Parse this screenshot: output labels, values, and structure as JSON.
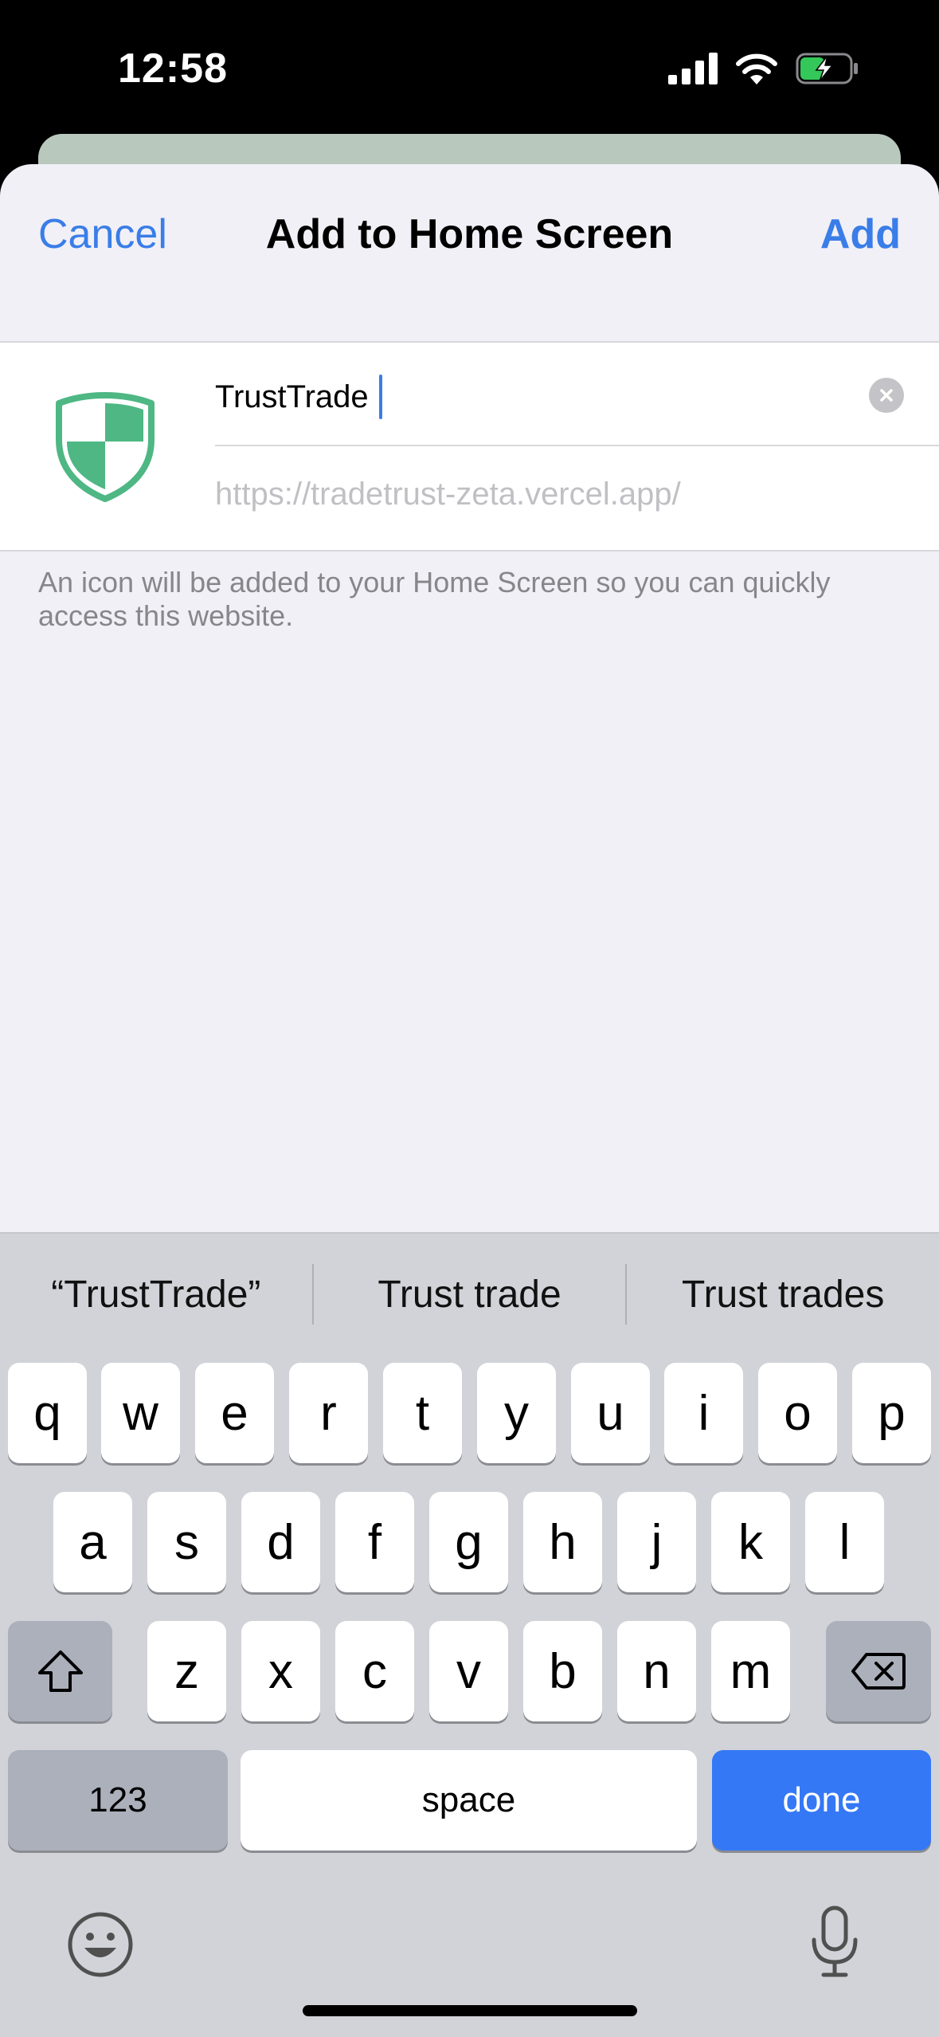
{
  "status_bar": {
    "time": "12:58"
  },
  "nav": {
    "cancel_label": "Cancel",
    "title": "Add to Home Screen",
    "add_label": "Add"
  },
  "form": {
    "name_value": "TrustTrade",
    "url": "https://tradetrust-zeta.vercel.app/",
    "helper_text": "An icon will be added to your Home Screen so you can quickly access this website."
  },
  "icon_colors": {
    "shield": "#4eb783",
    "accent": "#3a7de8"
  },
  "keyboard": {
    "suggestions": [
      "“TrustTrade”",
      "Trust trade",
      "Trust trades"
    ],
    "row1": [
      "q",
      "w",
      "e",
      "r",
      "t",
      "y",
      "u",
      "i",
      "o",
      "p"
    ],
    "row2": [
      "a",
      "s",
      "d",
      "f",
      "g",
      "h",
      "j",
      "k",
      "l"
    ],
    "row3": [
      "z",
      "x",
      "c",
      "v",
      "b",
      "n",
      "m"
    ],
    "numbers_label": "123",
    "space_label": "space",
    "done_label": "done"
  }
}
